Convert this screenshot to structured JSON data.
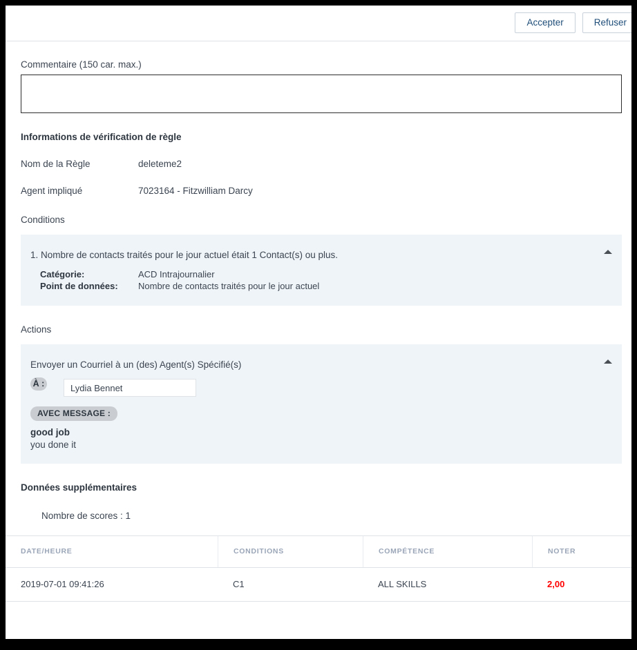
{
  "topbar": {
    "accept_label": "Accepter",
    "refuse_label": "Refuser"
  },
  "comment": {
    "label": "Commentaire (150 car. max.)",
    "value": "",
    "placeholder": ""
  },
  "rule_info": {
    "title": "Informations de vérification de règle",
    "rows": [
      {
        "key": "Nom de la Règle",
        "value": "deleteme2"
      },
      {
        "key": "Agent impliqué",
        "value": "7023164 - Fitzwilliam Darcy"
      }
    ]
  },
  "conditions": {
    "title": "Conditions",
    "statement": "1. Nombre de contacts traités pour le jour actuel était 1 Contact(s) ou plus.",
    "details": [
      {
        "key": "Catégorie:",
        "value": "ACD Intrajournalier"
      },
      {
        "key": "Point de données:",
        "value": "Nombre de contacts traités pour le jour actuel"
      }
    ]
  },
  "actions": {
    "title": "Actions",
    "action_name": "Envoyer un Courriel à un (des) Agent(s) Spécifié(s)",
    "to_label": "À :",
    "to_value": "Lydia Bennet",
    "message_badge": "AVEC MESSAGE :",
    "message_subject": "good job",
    "message_body": "you done it"
  },
  "extra_data": {
    "title": "Données supplémentaires",
    "score_count_line": "Nombre de scores : 1"
  },
  "table": {
    "columns": [
      "DATE/HEURE",
      "CONDITIONS",
      "COMPÉTENCE",
      "NOTER"
    ],
    "rows": [
      {
        "date": "2019-07-01 09:41:26",
        "condition": "C1",
        "skill": "ALL SKILLS",
        "score": "2,00"
      }
    ]
  },
  "colors": {
    "panel_bg": "#eff4f8",
    "accent_link": "#1f4e79",
    "score_red": "#ff0000",
    "badge_grey": "#c9cdd1"
  }
}
